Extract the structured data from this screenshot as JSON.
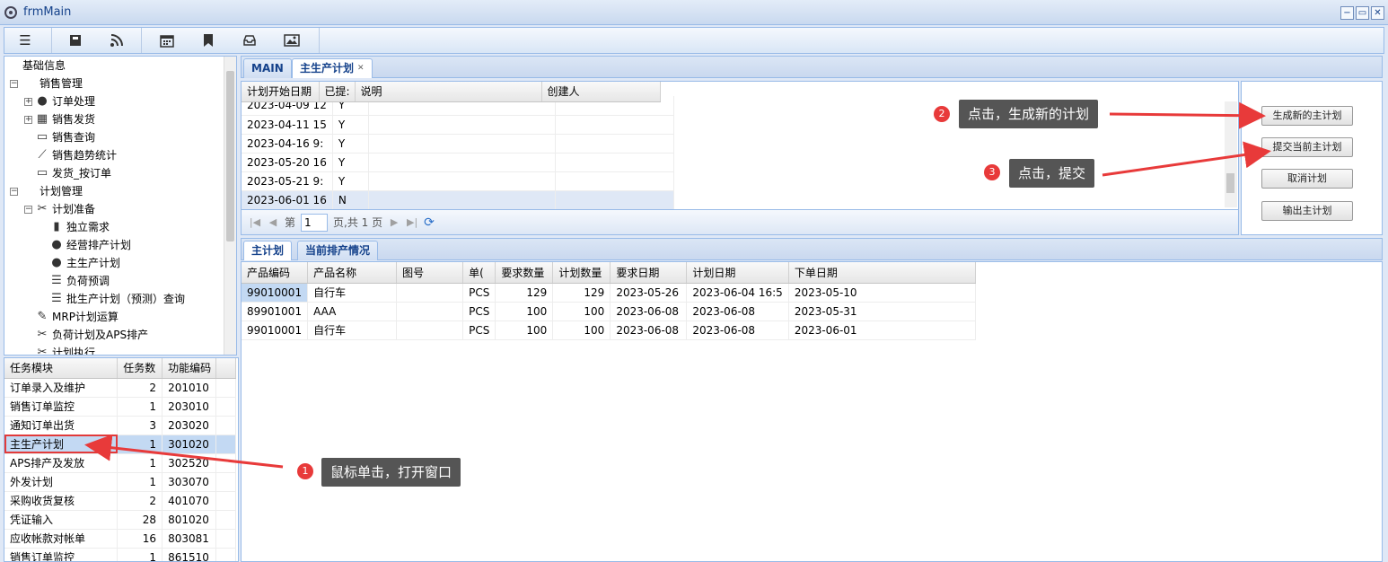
{
  "window": {
    "title": "frmMain",
    "minimize": "−",
    "restore": "▭",
    "close": "✕"
  },
  "toolbar": {
    "icons": [
      "menu-icon",
      "book-icon",
      "rss-icon",
      "calendar-icon",
      "bookmark-icon",
      "inbox-icon",
      "image-icon"
    ]
  },
  "tree": {
    "items": [
      {
        "label": "基础信息"
      },
      {
        "label": "销售管理"
      },
      {
        "label": "订单处理"
      },
      {
        "label": "销售发货"
      },
      {
        "label": "销售查询"
      },
      {
        "label": "销售趋势统计"
      },
      {
        "label": "发货_按订单"
      },
      {
        "label": "计划管理"
      },
      {
        "label": "计划准备"
      },
      {
        "label": "独立需求"
      },
      {
        "label": "经营排产计划"
      },
      {
        "label": "主生产计划"
      },
      {
        "label": "负荷预调"
      },
      {
        "label": "批生产计划（预测）查询"
      },
      {
        "label": "MRP计划运算"
      },
      {
        "label": "负荷计划及APS排产"
      },
      {
        "label": "计划执行"
      }
    ]
  },
  "task_grid": {
    "columns": [
      "任务模块",
      "任务数",
      "功能编码"
    ],
    "rows": [
      {
        "module": "订单录入及维护",
        "count": "2",
        "code": "201010"
      },
      {
        "module": "销售订单监控",
        "count": "1",
        "code": "203010"
      },
      {
        "module": "通知订单出货",
        "count": "3",
        "code": "203020"
      },
      {
        "module": "主生产计划",
        "count": "1",
        "code": "301020"
      },
      {
        "module": "APS排产及发放",
        "count": "1",
        "code": "302520"
      },
      {
        "module": "外发计划",
        "count": "1",
        "code": "303070"
      },
      {
        "module": "采购收货复核",
        "count": "2",
        "code": "401070"
      },
      {
        "module": "凭证输入",
        "count": "28",
        "code": "801020"
      },
      {
        "module": "应收帐款对帐单",
        "count": "16",
        "code": "803081"
      },
      {
        "module": "销售订单监控",
        "count": "1",
        "code": "861510"
      }
    ]
  },
  "main_tabs": [
    {
      "label": "MAIN"
    },
    {
      "label": "主生产计划",
      "close": "✕"
    }
  ],
  "plan_grid": {
    "columns": [
      "计划开始日期",
      "已提:",
      "说明",
      "创建人"
    ],
    "rows": [
      {
        "date": "2023-04-09 12",
        "submitted": "Y"
      },
      {
        "date": "2023-04-11 15",
        "submitted": "Y"
      },
      {
        "date": "2023-04-16 9:",
        "submitted": "Y"
      },
      {
        "date": "2023-05-20 16",
        "submitted": "Y"
      },
      {
        "date": "2023-05-21 9:",
        "submitted": "Y"
      },
      {
        "date": "2023-06-01 16",
        "submitted": "N"
      }
    ]
  },
  "pager": {
    "page_label": "第",
    "page_value": "1",
    "total_label": "页,共 1 页"
  },
  "actions": {
    "generate": "生成新的主计划",
    "submit": "提交当前主计划",
    "cancel": "取消计划",
    "export": "输出主计划"
  },
  "sub_tabs": [
    {
      "label": "主计划"
    },
    {
      "label": "当前排产情况"
    }
  ],
  "detail_grid": {
    "columns": [
      "产品编码",
      "产品名称",
      "图号",
      "单(",
      "要求数量",
      "计划数量",
      "要求日期",
      "计划日期",
      "下单日期"
    ],
    "rows": [
      {
        "code": "99010001",
        "name": "自行车",
        "drawing": "",
        "unit": "PCS",
        "req_qty": "129",
        "plan_qty": "129",
        "req_date": "2023-05-26",
        "plan_date": "2023-06-04 16:5",
        "order_date": "2023-05-10"
      },
      {
        "code": "89901001",
        "name": "AAA",
        "drawing": "",
        "unit": "PCS",
        "req_qty": "100",
        "plan_qty": "100",
        "req_date": "2023-06-08",
        "plan_date": "2023-06-08",
        "order_date": "2023-05-31"
      },
      {
        "code": "99010001",
        "name": "自行车",
        "drawing": "",
        "unit": "PCS",
        "req_qty": "100",
        "plan_qty": "100",
        "req_date": "2023-06-08",
        "plan_date": "2023-06-08",
        "order_date": "2023-06-01"
      }
    ]
  },
  "callouts": [
    {
      "num": "1",
      "text": "鼠标单击，打开窗口"
    },
    {
      "num": "2",
      "text": "点击，生成新的计划"
    },
    {
      "num": "3",
      "text": "点击，提交"
    }
  ],
  "colors": {
    "callout_bg": "#555555",
    "badge": "#e83a3a",
    "arrow": "#e83a3a",
    "panel_border": "#99bbe8",
    "tab_text": "#15428b"
  }
}
